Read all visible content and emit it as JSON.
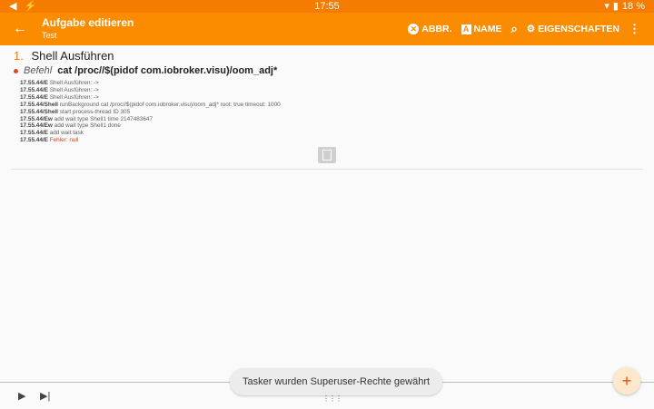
{
  "status_bar": {
    "time": "17:55",
    "battery": "18 %",
    "left_icons": [
      "nav-arrow-icon",
      "flash-icon"
    ],
    "right_icons": [
      "wifi-icon",
      "battery-icon"
    ]
  },
  "app_bar": {
    "title": "Aufgabe editieren",
    "subtitle": "Test",
    "actions": {
      "cancel_label": "ABBR.",
      "name_label": "NAME",
      "properties_label": "EIGENSCHAFTEN"
    }
  },
  "step": {
    "number": "1.",
    "title": "Shell Ausführen",
    "command_label": "Befehl",
    "command_value": "cat /proc//$(pidof com.iobroker.visu)/oom_adj*"
  },
  "log": [
    {
      "time": "17.55.44/E",
      "text": "Shell Ausführen: ->",
      "error": false
    },
    {
      "time": "17.55.44/E",
      "text": "Shell Ausführen: ->",
      "error": false
    },
    {
      "time": "17.55.44/E",
      "text": "Shell Ausführen: ->",
      "error": false
    },
    {
      "time": "17.55.44/Shell",
      "text": "runBackground cat /proc//$(pidof com.iobroker.visu)/oom_adj* root: true timeout: 1000",
      "error": false
    },
    {
      "time": "17.55.44/Shell",
      "text": "start process-thread ID 305",
      "error": false
    },
    {
      "time": "17.55.44/Ew",
      "text": "add wait type Shell1 time 2147483647",
      "error": false
    },
    {
      "time": "17.55.44/Ew",
      "text": "add wait type Shell1 done",
      "error": false
    },
    {
      "time": "17.55.44/E",
      "text": "add wait task",
      "error": false
    },
    {
      "time": "17.55.44/E",
      "text": "Fehler: null",
      "error": true
    }
  ],
  "toast": "Tasker wurden Superuser-Rechte gewährt",
  "colors": {
    "accent": "#fb8c00",
    "statusbar": "#f57c00",
    "error": "#d84315"
  }
}
